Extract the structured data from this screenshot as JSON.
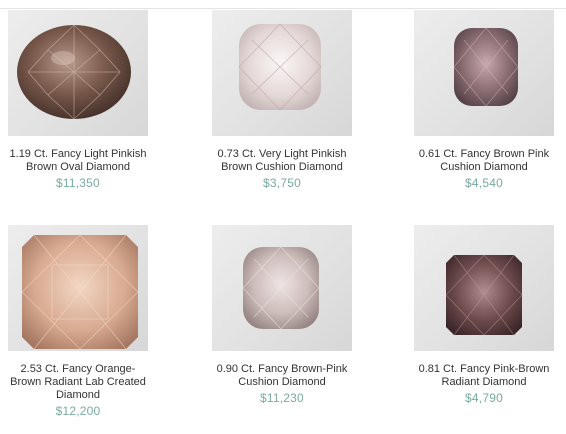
{
  "products": [
    {
      "title": "1.19 Ct. Fancy Light Pinkish Brown Oval Diamond",
      "price": "$11,350",
      "icon": "oval-diamond-image",
      "color": "#6e5347"
    },
    {
      "title": "0.73 Ct. Very Light Pinkish Brown Cushion Diamond",
      "price": "$3,750",
      "icon": "cushion-diamond-image",
      "color": "#e6dcdb"
    },
    {
      "title": "0.61 Ct. Fancy Brown Pink Cushion Diamond",
      "price": "$4,540",
      "icon": "cushion-diamond-image",
      "color": "#8a6d73"
    },
    {
      "title": "2.53 Ct. Fancy Orange-Brown Radiant Lab Created Diamond",
      "price": "$12,200",
      "icon": "radiant-diamond-image",
      "color": "#d9ab91"
    },
    {
      "title": "0.90 Ct. Fancy Brown-Pink Cushion Diamond",
      "price": "$11,230",
      "icon": "cushion-diamond-image",
      "color": "#cdbdbb"
    },
    {
      "title": "0.81 Ct. Fancy Pink-Brown Radiant Diamond",
      "price": "$4,790",
      "icon": "radiant-diamond-image",
      "color": "#6f4c4e"
    }
  ]
}
